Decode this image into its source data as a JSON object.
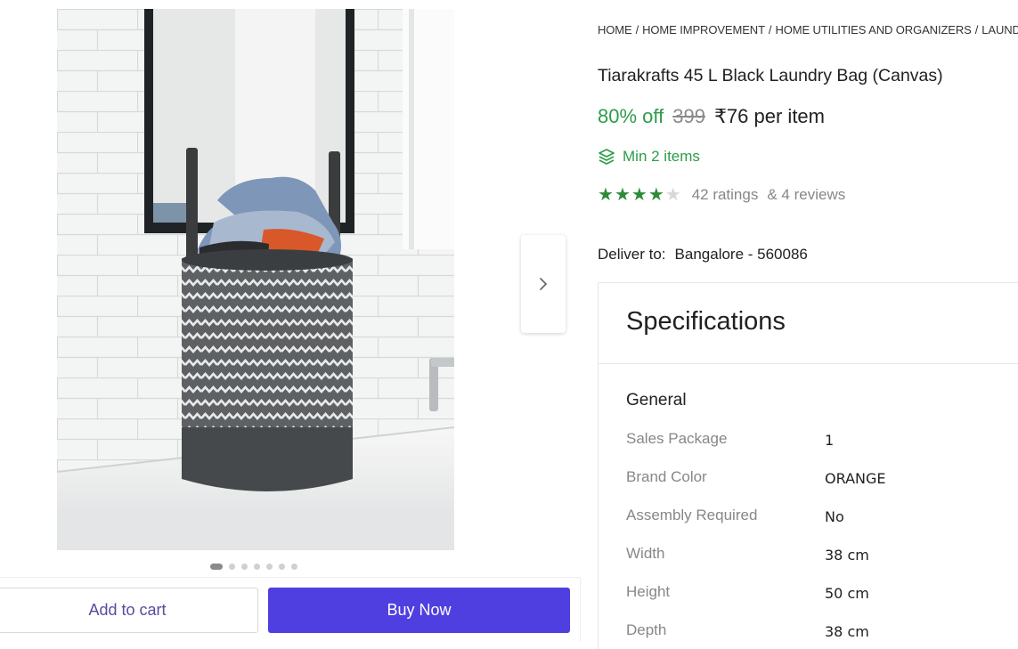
{
  "gallery": {
    "image_alt": "Laundry bag product photo",
    "dots_count": 7,
    "active_dot": 0
  },
  "actions": {
    "add_to_cart": "Add to cart",
    "buy_now": "Buy Now"
  },
  "breadcrumb": [
    "HOME",
    "HOME IMPROVEMENT",
    "HOME UTILITIES AND ORGANIZERS",
    "LAUNDRY"
  ],
  "product": {
    "title": "Tiarakrafts 45 L Black Laundry Bag (Canvas)",
    "discount": "80% off",
    "mrp": "399",
    "price": "₹76 per item",
    "min_items": "Min 2 items",
    "stars": 4,
    "ratings": "42 ratings",
    "reviews": "& 4 reviews"
  },
  "delivery": {
    "label": "Deliver to:",
    "location": "Bangalore - 560086"
  },
  "specifications": {
    "title": "Specifications",
    "group": "General",
    "rows": [
      {
        "key": "Sales Package",
        "value": "1"
      },
      {
        "key": "Brand Color",
        "value": "ORANGE"
      },
      {
        "key": "Assembly Required",
        "value": "No"
      },
      {
        "key": "Width",
        "value": "38 cm"
      },
      {
        "key": "Height",
        "value": "50 cm"
      },
      {
        "key": "Depth",
        "value": "38 cm"
      }
    ]
  },
  "colors": {
    "green": "#2e9b4a",
    "buy_button": "#4f3ee0",
    "cart_text": "#5b4a9e"
  },
  "icons": {
    "next": "chevron-right-icon",
    "min_items": "layers-icon",
    "star": "star-icon"
  }
}
